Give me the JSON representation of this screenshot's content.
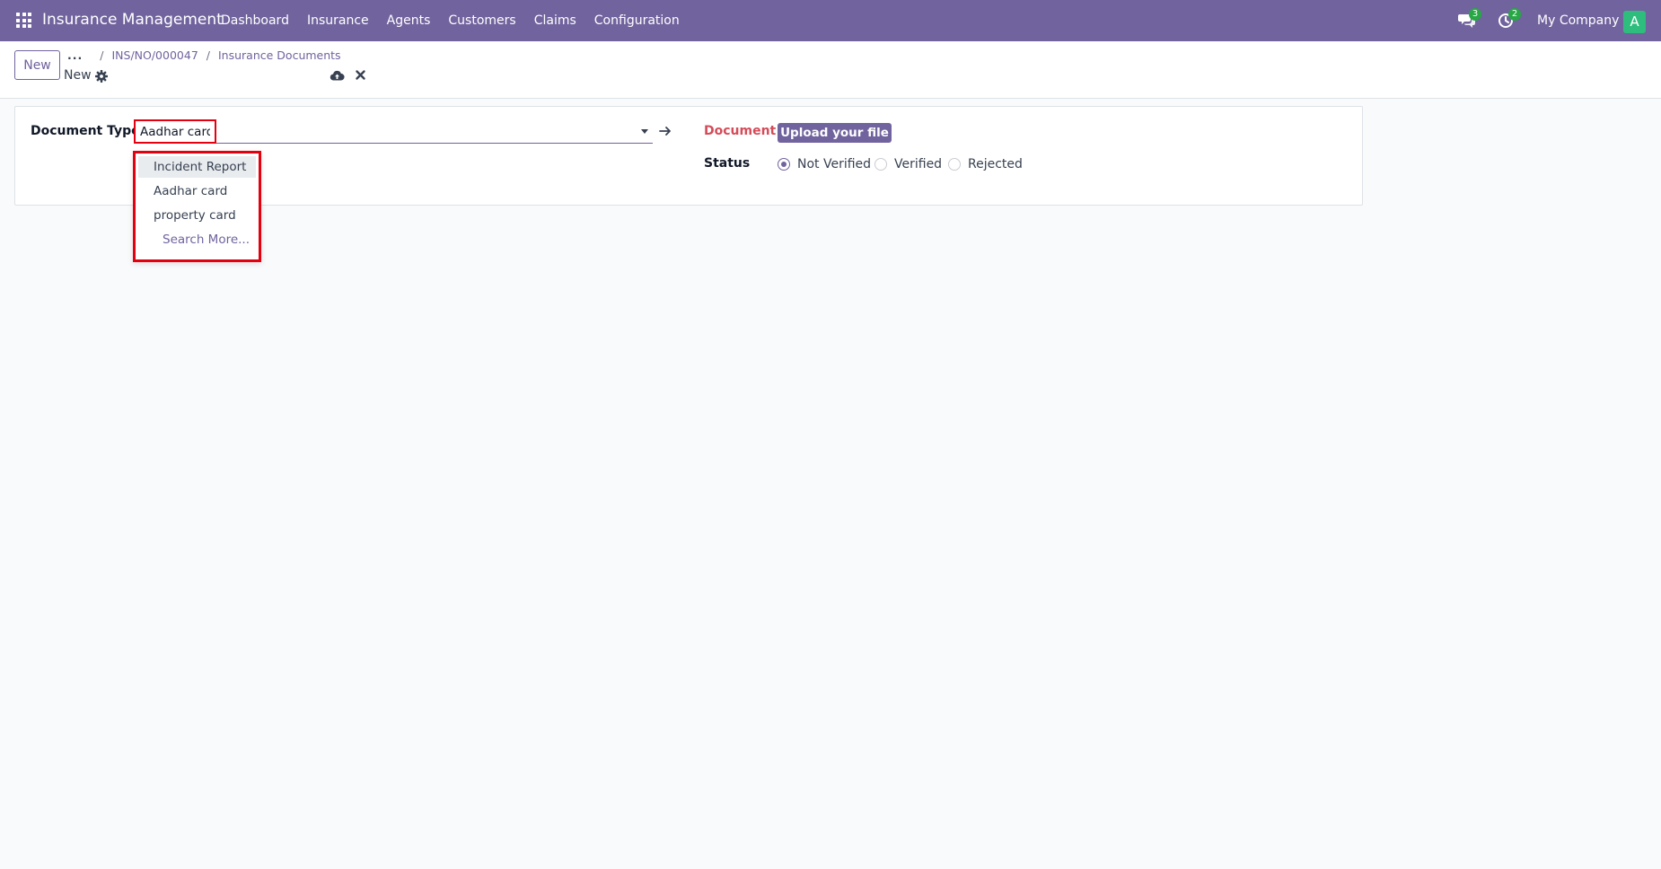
{
  "navbar": {
    "brand": "Insurance Management",
    "menu": [
      "Dashboard",
      "Insurance",
      "Agents",
      "Customers",
      "Claims",
      "Configuration"
    ],
    "messages_badge": "3",
    "activities_badge": "2",
    "company": "My Company",
    "avatar_initial": "A",
    "colors": {
      "navbar": "#71639e",
      "badge": "#28a745",
      "avatar": "#2ebd7d"
    }
  },
  "control_panel": {
    "new_label": "New",
    "breadcrumb": {
      "more": "...",
      "separator": "/",
      "parent": "INS/NO/000047",
      "current": "Insurance Documents"
    },
    "record_title": "New"
  },
  "form": {
    "document_type_label": "Document Type",
    "document_type_value": "Aadhar card",
    "document_label": "Document",
    "upload_label": "Upload your file",
    "status_label": "Status",
    "status_options": [
      "Not Verified",
      "Verified",
      "Rejected"
    ],
    "status_selected": "Not Verified"
  },
  "dropdown": {
    "items": [
      "Incident Report",
      "Aadhar card",
      "property card"
    ],
    "highlighted": "Incident Report",
    "search_more": "Search More..."
  }
}
